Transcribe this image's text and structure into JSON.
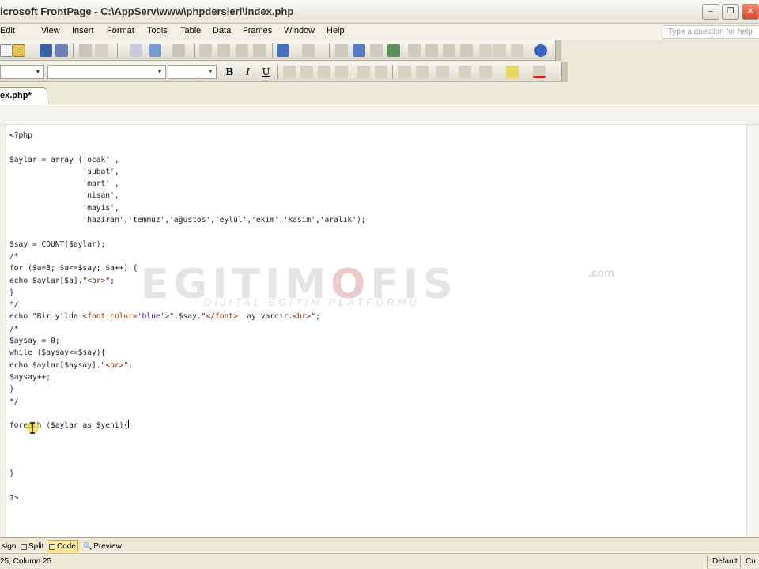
{
  "window": {
    "title": "Microsoft FrontPage - C:\\AppServ\\www\\phpdersleri\\index.php",
    "title_visible": "icrosoft FrontPage - C:\\AppServ\\www\\phpdersleri\\index.php",
    "buttons": {
      "minimize": "–",
      "restore": "❐",
      "close": "✕"
    }
  },
  "menu": {
    "items": [
      "Edit",
      "View",
      "Insert",
      "Format",
      "Tools",
      "Table",
      "Data",
      "Frames",
      "Window",
      "Help"
    ],
    "help_search_placeholder": "Type a question for help"
  },
  "formatting_toolbar": {
    "bold": "B",
    "italic": "I",
    "underline": "U"
  },
  "document": {
    "tab_label": "ex.php*"
  },
  "code_lines": [
    "<?php",
    "",
    "$aylar = array ('ocak' ,",
    "                'subat',",
    "                'mart' ,",
    "                'nisan',",
    "                'mayis',",
    "                'haziran','temmuz','ağustos','eylül','ekim','kasım','aralık');",
    "",
    "$say = COUNT($aylar);",
    "/*",
    "for ($a=3; $a<=$say; $a++) {",
    "echo $aylar[$a].\"<br>\";",
    "}",
    "*/",
    "echo \"Bir yılda <font color='blue'>\".$say.\"</font>  ay vardır.<br>\";",
    "/*",
    "$aysay = 0;",
    "while ($aysay<=$say){",
    "echo $aylar[$aysay].\"<br>\";",
    "$aysay++;",
    "}",
    "*/",
    "",
    "foreach ($aylar as $yeni){",
    "",
    "",
    "",
    "}",
    "",
    "?>"
  ],
  "watermark": {
    "main_prefix": "EGITIM",
    "main_o": "O",
    "main_suffix": "FIS",
    "domain": ".com",
    "subtitle": "DIJITAL EGITIM PLATFORMU"
  },
  "view_tabs": [
    {
      "label": "sign",
      "active": false
    },
    {
      "label": "Split",
      "active": false
    },
    {
      "label": "Code",
      "active": true
    },
    {
      "label": "Preview",
      "active": false
    }
  ],
  "status": {
    "position": "25, Column 25",
    "mode": "Default",
    "extra": "Cu"
  },
  "colors": {
    "editor_bg": "#ffffff",
    "chrome_bg": "#ece9d8",
    "active_tab_bg": "#ffe9a9",
    "string_tag": "#7a2a00",
    "string_value": "#1a1acc"
  }
}
